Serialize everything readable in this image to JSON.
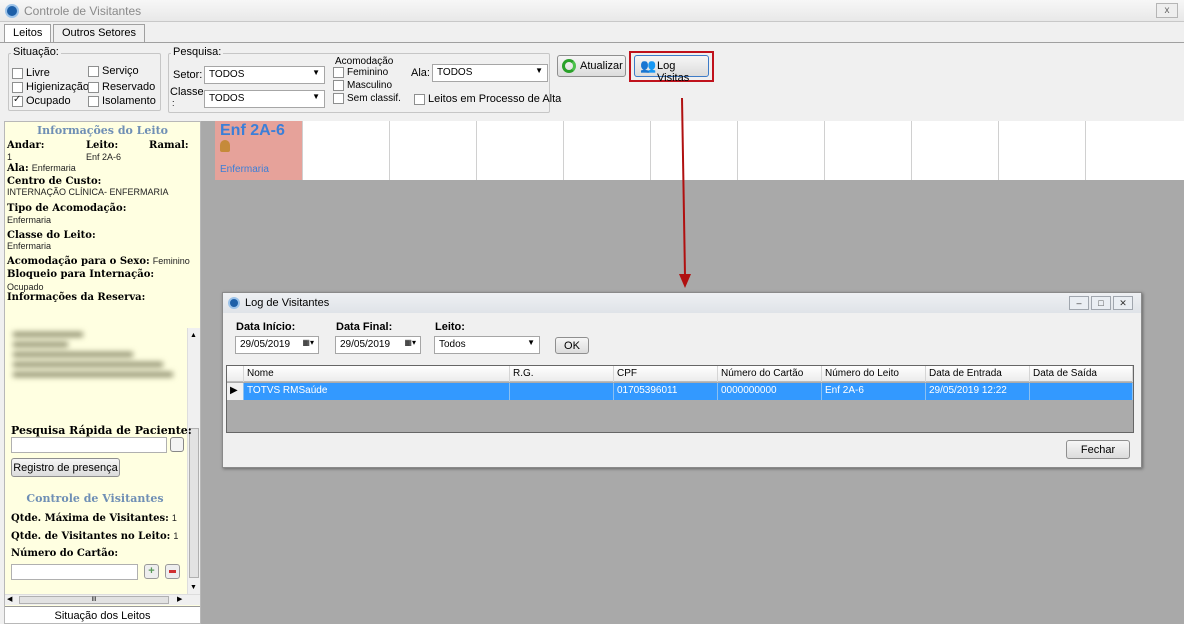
{
  "window": {
    "title": "Controle de Visitantes",
    "close_label": "x"
  },
  "tabs": [
    {
      "label": "Leitos"
    },
    {
      "label": "Outros Setores"
    }
  ],
  "situacao": {
    "label": "Situação:",
    "options": [
      {
        "label": "Livre",
        "checked": false
      },
      {
        "label": "Serviço",
        "checked": false
      },
      {
        "label": "Higienização",
        "checked": false
      },
      {
        "label": "Reservado",
        "checked": false
      },
      {
        "label": "Ocupado",
        "checked": true
      },
      {
        "label": "Isolamento",
        "checked": false
      }
    ]
  },
  "pesquisa": {
    "label": "Pesquisa:",
    "setor_label": "Setor:",
    "setor_value": "TODOS",
    "classe_label": "Classe",
    "classe_colon": ":",
    "classe_value": "TODOS",
    "acomodacao_label": "Acomodação",
    "acomodacao_options": [
      {
        "label": "Feminino"
      },
      {
        "label": "Masculino"
      },
      {
        "label": "Sem classif."
      }
    ],
    "ala_label": "Ala:",
    "ala_value": "TODOS",
    "alta_label": "Leitos em Processo de Alta"
  },
  "toolbar": {
    "atualizar_label": "Atualizar",
    "log_visitas_label": "Log Visitas"
  },
  "info": {
    "heading": "Informações do Leito",
    "andar_label": "Andar:",
    "andar_value": "1",
    "leito_label": "Leito:",
    "leito_value": "Enf 2A-6",
    "ramal_label": "Ramal:",
    "ala_label": "Ala:",
    "ala_value": "Enfermaria",
    "centro_label": "Centro de Custo:",
    "centro_value": "INTERNAÇÃO CLÍNICA- ENFERMARIA",
    "tipo_label": "Tipo de Acomodação:",
    "tipo_value": "Enfermaria",
    "classe_label": "Classe do Leito:",
    "classe_value": "Enfermaria",
    "sexo_label": "Acomodação para o Sexo:",
    "sexo_value": "Feminino",
    "bloqueio_label": "Bloqueio para Internação:",
    "bloqueio_value": "Ocupado",
    "reserva_label": "Informações da Reserva:",
    "pesquisa_rapida_label": "Pesquisa Rápida de Paciente:",
    "registro_button": "Registro de presença",
    "controle_heading": "Controle de Visitantes",
    "qtde_max_label": "Qtde. Máxima de Visitantes:",
    "qtde_max_value": "1",
    "qtde_leito_label": "Qtde. de Visitantes no Leito:",
    "qtde_leito_value": "1",
    "cartao_label": "Número do Cartão:",
    "situacao_leitos": "Situação dos Leitos",
    "scroll_thumb": "III"
  },
  "bed": {
    "code": "Enf 2A-6",
    "type": "Enfermaria",
    "color": "#e6a29a"
  },
  "dialog": {
    "title": "Log de Visitantes",
    "data_inicio_label": "Data Início:",
    "data_inicio_value": "29/05/2019",
    "data_final_label": "Data Final:",
    "data_final_value": "29/05/2019",
    "leito_label": "Leito:",
    "leito_value": "Todos",
    "ok_label": "OK",
    "fechar_label": "Fechar",
    "columns": [
      "Nome",
      "R.G.",
      "CPF",
      "Número do Cartão",
      "Número do Leito",
      "Data de Entrada",
      "Data de Saída"
    ],
    "rows": [
      [
        "TOTVS RMSaúde",
        "",
        "01705396011",
        "0000000000",
        "Enf 2A-6",
        "29/05/2019 12:22",
        ""
      ]
    ]
  },
  "colors": {
    "accent_red": "#c0121c",
    "selection": "#3399ff",
    "info_bg": "#ffffe1"
  }
}
